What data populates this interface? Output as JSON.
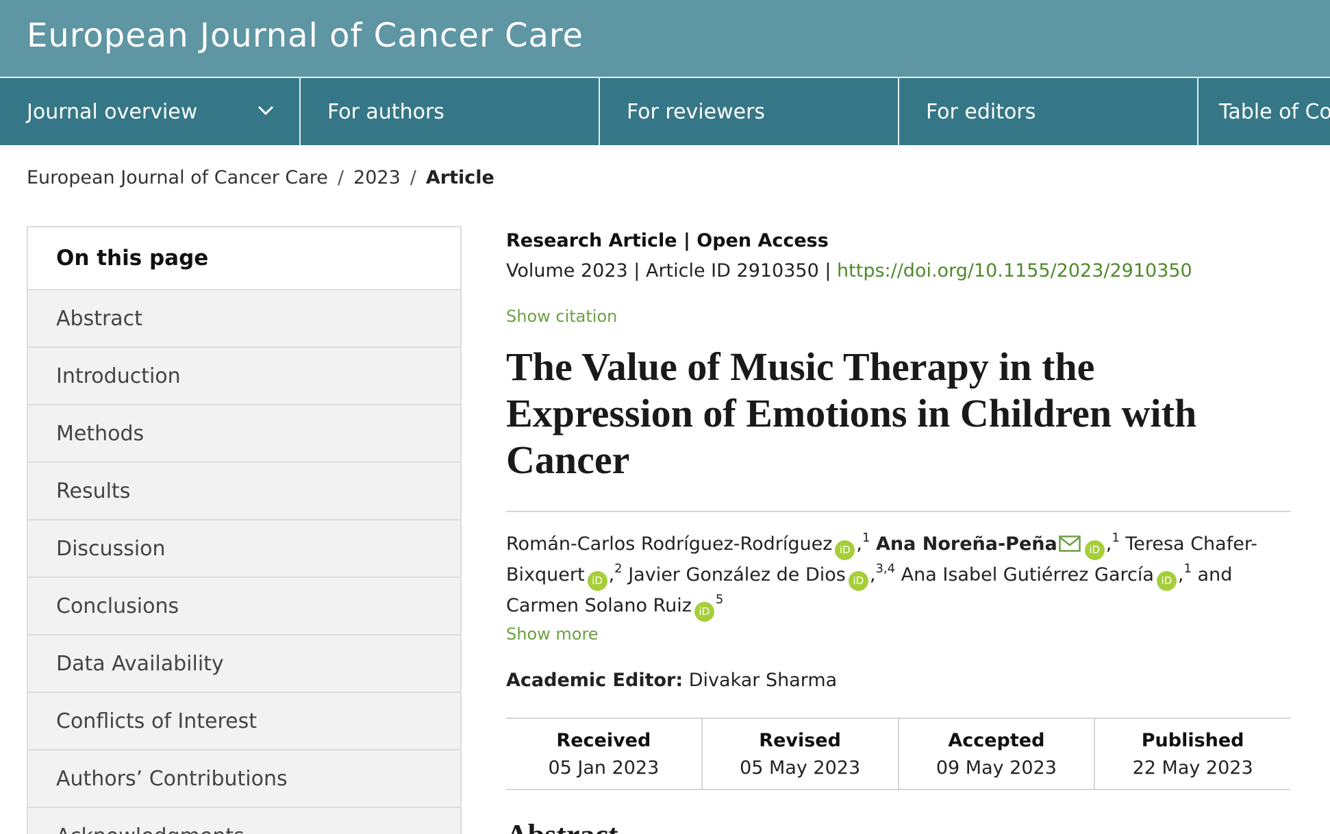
{
  "header": {
    "journal_title": "European Journal of Cancer Care"
  },
  "nav": {
    "items": [
      {
        "label": "Journal overview",
        "has_dropdown": true,
        "icon": "chevron-down-icon"
      },
      {
        "label": "For authors"
      },
      {
        "label": "For reviewers"
      },
      {
        "label": "For editors"
      },
      {
        "label": "Table of Co"
      }
    ]
  },
  "breadcrumb": {
    "items": [
      "European Journal of Cancer Care",
      "2023",
      "Article"
    ],
    "separator": "/"
  },
  "toc": {
    "heading": "On this page",
    "items": [
      "Abstract",
      "Introduction",
      "Methods",
      "Results",
      "Discussion",
      "Conclusions",
      "Data Availability",
      "Conflicts of Interest",
      "Authors’ Contributions",
      "Acknowledgments"
    ]
  },
  "article": {
    "type_label": "Research Article | Open Access",
    "volume_text": "Volume 2023 | Article ID 2910350 | ",
    "doi": "https://doi.org/10.1155/2023/2910350",
    "show_citation": "Show citation",
    "title": "The Value of Music Therapy in the Expression of Emotions in Children with Cancer",
    "authors": [
      {
        "name": "Román-Carlos Rodríguez-Rodríguez",
        "affiliation": "1",
        "orcid": true
      },
      {
        "name": "Ana Noreña-Peña",
        "affiliation": "1",
        "orcid": true,
        "corresponding": true
      },
      {
        "name": "Teresa Chafer-Bixquert",
        "affiliation": "2",
        "orcid": true
      },
      {
        "name": "Javier González de Dios",
        "affiliation": "3,4",
        "orcid": true
      },
      {
        "name": "Ana Isabel Gutiérrez García",
        "affiliation": "1",
        "orcid": true
      },
      {
        "name": "Carmen Solano Ruiz",
        "affiliation": "5",
        "orcid": true
      }
    ],
    "authors_conjunction": "and",
    "orcid_icon_label": "iD",
    "show_more": "Show more",
    "academic_editor_label": "Academic Editor:",
    "academic_editor": "Divakar Sharma",
    "dates": [
      {
        "label": "Received",
        "value": "05 Jan 2023"
      },
      {
        "label": "Revised",
        "value": "05 May 2023"
      },
      {
        "label": "Accepted",
        "value": "09 May 2023"
      },
      {
        "label": "Published",
        "value": "22 May 2023"
      }
    ],
    "next_section_heading": "Abstract"
  },
  "colors": {
    "header_bg": "#5e96a3",
    "nav_bg": "#357786",
    "link_green": "#4e8a2a",
    "orcid_green": "#a6ce39"
  }
}
